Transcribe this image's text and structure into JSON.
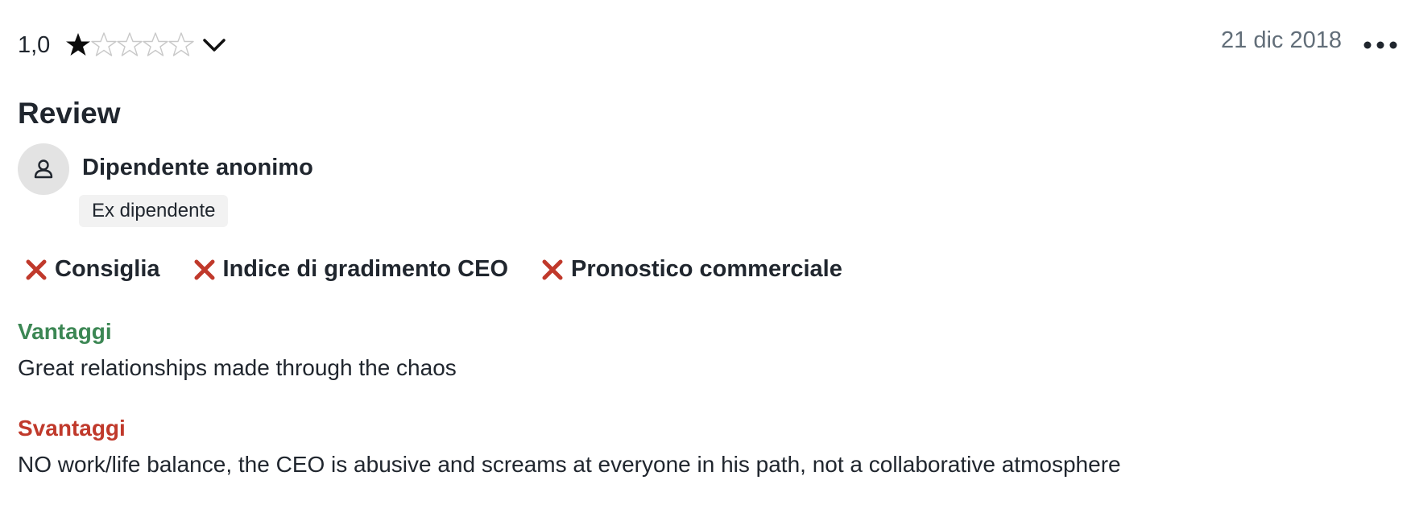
{
  "review": {
    "rating_value": "1,0",
    "rating": 1,
    "rating_max": 5,
    "date": "21 dic 2018",
    "title": "Review",
    "author": "Dipendente anonimo",
    "status_badge": "Ex dipendente",
    "flags": [
      {
        "label": "Consiglia",
        "status": "negative",
        "icon": "x-icon"
      },
      {
        "label": "Indice di gradimento CEO",
        "status": "negative",
        "icon": "x-icon"
      },
      {
        "label": "Pronostico commerciale",
        "status": "negative",
        "icon": "x-icon"
      }
    ],
    "pros_title": "Vantaggi",
    "pros_text": "Great relationships made through the chaos",
    "cons_title": "Svantaggi",
    "cons_text": "NO work/life balance, the CEO is abusive and screams at everyone in his path, not a collaborative atmosphere"
  },
  "icons": {
    "expand": "chevron-down-icon",
    "more": "more-options-icon",
    "avatar": "user-icon"
  },
  "colors": {
    "pros": "#3c8754",
    "cons": "#c0392b",
    "negative_flag": "#c0392b",
    "date": "#626e79",
    "star_filled": "#0c0c0c",
    "star_empty": "#c9c9c9"
  }
}
